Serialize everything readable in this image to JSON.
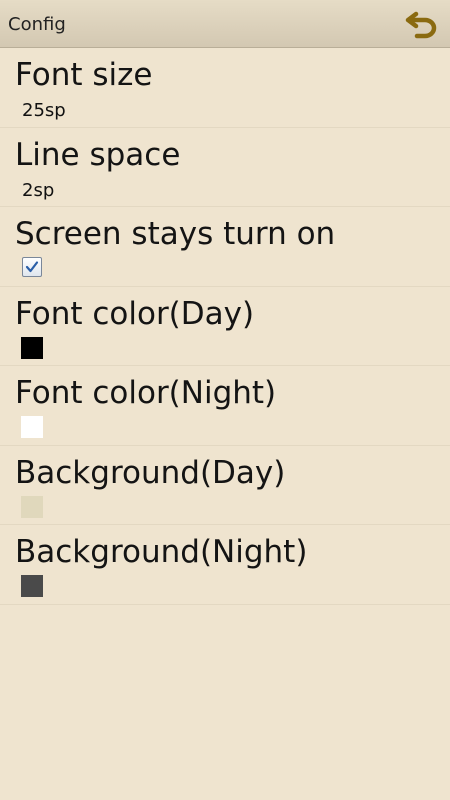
{
  "header": {
    "title": "Config",
    "back_icon": "back-arrow-icon"
  },
  "settings": [
    {
      "key": "font_size",
      "label": "Font size",
      "value": "25sp"
    },
    {
      "key": "line_space",
      "label": "Line space",
      "value": "2sp"
    },
    {
      "key": "screen_on",
      "label": "Screen stays turn on",
      "checked": true
    },
    {
      "key": "font_color_day",
      "label": "Font color(Day)",
      "color": "#000000"
    },
    {
      "key": "font_color_night",
      "label": "Font color(Night)",
      "color": "#ffffff"
    },
    {
      "key": "background_day",
      "label": "Background(Day)",
      "color": "#e0d8bc"
    },
    {
      "key": "background_night",
      "label": "Background(Night)",
      "color": "#4a4a4a"
    }
  ],
  "colors": {
    "page_background": "#efe4cf",
    "titlebar_start": "#e6dcc6",
    "titlebar_end": "#d3c8b2",
    "back_icon": "#8a6a10",
    "checkbox_check": "#2b5fa8"
  }
}
